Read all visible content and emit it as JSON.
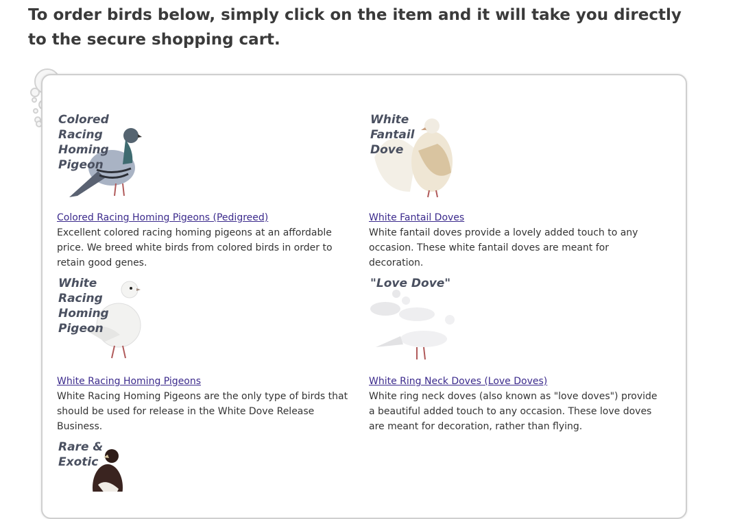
{
  "intro_text": "To order birds below, simply click on the item and it will take you directly to the secure shopping cart.",
  "colors": {
    "link": "#3b2a8c",
    "text": "#333333",
    "heading": "#3a3a3a",
    "panel_border": "#cfcfcf"
  },
  "items": [
    {
      "image_label": "Colored\nRacing\nHoming\nPigeon",
      "image_icon": "colored-pigeon-icon",
      "title": "Colored Racing Homing Pigeons (Pedigreed)",
      "description": "Excellent colored racing homing pigeons at an affordable price. We breed white birds from colored birds in order to retain good genes."
    },
    {
      "image_label": "White\nFantail\nDove",
      "image_icon": "fantail-dove-icon",
      "title": "White Fantail Doves",
      "description": "White fantail doves provide a lovely added touch to any occasion. These white fantail doves are meant for decoration."
    },
    {
      "image_label": "White\nRacing\nHoming\nPigeon",
      "image_icon": "white-pigeon-icon",
      "title": "White Racing Homing Pigeons",
      "description": "White Racing Homing Pigeons are the only type of birds that should be used for release in the White Dove Release Business."
    },
    {
      "image_label": "\"Love Dove\"",
      "image_icon": "love-doves-icon",
      "title": "White Ring Neck Doves (Love Doves)",
      "description": "White ring neck doves (also known as \"love doves\") provide a beautiful added touch to any occasion. These love doves are meant for decoration, rather than flying."
    },
    {
      "image_label": "Rare &\nExotic",
      "image_icon": "exotic-bird-icon"
    }
  ]
}
